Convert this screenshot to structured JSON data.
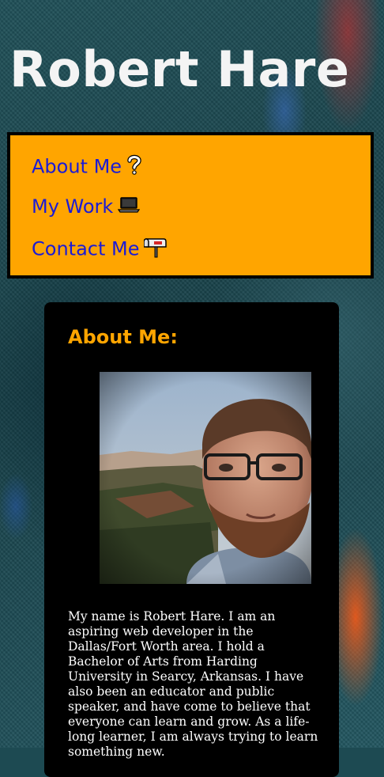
{
  "header": {
    "title": "Robert Hare"
  },
  "nav": {
    "items": [
      {
        "label": "About Me",
        "icon": "question-mark-icon"
      },
      {
        "label": "My Work",
        "icon": "laptop-icon"
      },
      {
        "label": "Contact Me",
        "icon": "mailbox-icon"
      }
    ]
  },
  "about": {
    "heading": "About Me:",
    "photo_icon": "profile-photo",
    "text": "My name is Robert Hare. I am an aspiring web developer in the Dallas/Fort Worth area. I hold a Bachelor of Arts from Harding University in Searcy, Arkansas. I have also been an educator and public speaker, and have come to believe that everyone can learn and grow. As a life-long learner, I am always trying to learn something new."
  },
  "colors": {
    "nav_background": "#ffa500",
    "heading_accent": "#ffa500",
    "link": "#1b1bd6",
    "card_background": "#000000",
    "title_text": "#f4f4f4"
  }
}
